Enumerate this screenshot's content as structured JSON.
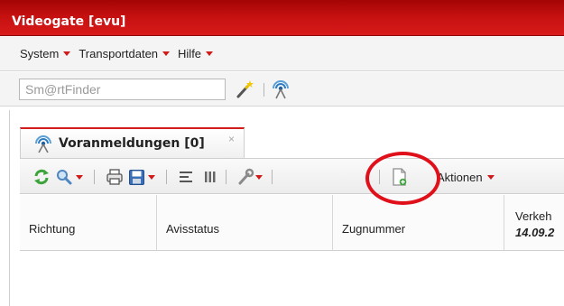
{
  "window": {
    "title": "Videogate [evu]"
  },
  "menubar": {
    "items": [
      {
        "label": "System"
      },
      {
        "label": "Transportdaten"
      },
      {
        "label": "Hilfe"
      }
    ]
  },
  "search": {
    "placeholder": "Sm@rtFinder"
  },
  "tab": {
    "label": "Voranmeldungen [0]",
    "close": "×"
  },
  "toolbar": {
    "aktionen_label": "Aktionen"
  },
  "grid": {
    "columns": [
      {
        "label": "Richtung"
      },
      {
        "label": "Avisstatus"
      },
      {
        "label": "Zugnummer"
      },
      {
        "label": "Verkeh",
        "sub": "14.09.2"
      }
    ]
  },
  "colors": {
    "accent": "#d21c1c",
    "title_bar": "#c51010",
    "highlight": "#e0101b"
  }
}
